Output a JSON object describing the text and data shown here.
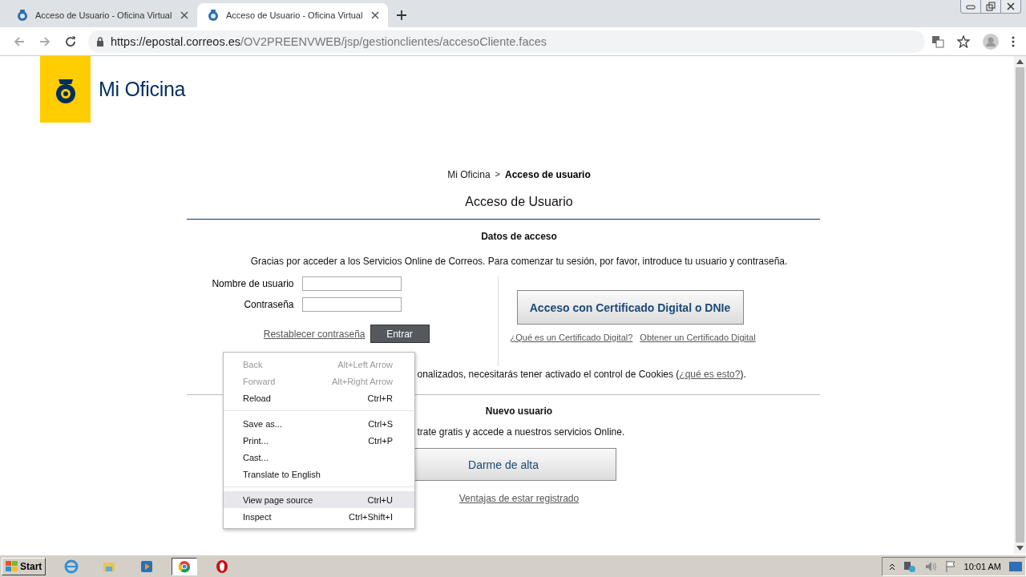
{
  "browser": {
    "tabs": [
      {
        "title": "Acceso de Usuario - Oficina Virtual",
        "selected": false
      },
      {
        "title": "Acceso de Usuario - Oficina Virtual",
        "selected": true
      }
    ],
    "url": {
      "host": "https://epostal.correos.es",
      "path": "/OV2PREENVWEB/jsp/gestionclientes/accesoCliente.faces"
    }
  },
  "page": {
    "logo_text": "Mi Oficina",
    "breadcrumb": [
      {
        "label": "Mi Oficina",
        "current": false
      },
      {
        "label": "Acceso de usuario",
        "current": true
      }
    ],
    "breadcrumb_separator": ">",
    "title": "Acceso de Usuario",
    "login": {
      "heading": "Datos de acceso",
      "intro": "Gracias por acceder a los Servicios Online de Correos. Para comenzar tu sesión, por favor, introduce tu usuario y contraseña.",
      "fields": [
        {
          "label": "Nombre de usuario"
        },
        {
          "label": "Contraseña"
        }
      ],
      "reset_link": "Restablecer contraseña",
      "submit": "Entrar",
      "cert_button": "Acceso con Certificado Digital o DNIe",
      "cert_links": [
        "¿Qué es un Certificado Digital?",
        "Obtener un Certificado Digital"
      ],
      "cookies_note": "onalizados, necesitarás tener activado el control de Cookies (",
      "cookies_link": "¿qué es esto?",
      "cookies_end": ")."
    },
    "new_user": {
      "heading": "Nuevo usuario",
      "text": "trate gratis y accede a nuestros servicios Online.",
      "button": "Darme de alta",
      "link": "Ventajas de estar registrado"
    }
  },
  "context_menu": {
    "groups": [
      [
        {
          "label": "Back",
          "shortcut": "Alt+Left Arrow",
          "disabled": true,
          "selected": false
        },
        {
          "label": "Forward",
          "shortcut": "Alt+Right Arrow",
          "disabled": true,
          "selected": false
        },
        {
          "label": "Reload",
          "shortcut": "Ctrl+R",
          "disabled": false,
          "selected": false
        }
      ],
      [
        {
          "label": "Save as...",
          "shortcut": "Ctrl+S",
          "disabled": false,
          "selected": false
        },
        {
          "label": "Print...",
          "shortcut": "Ctrl+P",
          "disabled": false,
          "selected": false
        },
        {
          "label": "Cast...",
          "disabled": false,
          "selected": false
        },
        {
          "label": "Translate to English",
          "disabled": false,
          "selected": false
        }
      ],
      [
        {
          "label": "View page source",
          "shortcut": "Ctrl+U",
          "disabled": false,
          "selected": true
        },
        {
          "label": "Inspect",
          "shortcut": "Ctrl+Shift+I",
          "disabled": false,
          "selected": false
        }
      ]
    ]
  },
  "taskbar": {
    "start": "Start",
    "apps": [
      {
        "kind": "ie",
        "selected": false
      },
      {
        "kind": "folder",
        "selected": false
      },
      {
        "kind": "media",
        "selected": false
      },
      {
        "kind": "chrome",
        "selected": true
      },
      {
        "kind": "opera",
        "selected": false
      }
    ],
    "clock": "10:01 AM"
  }
}
